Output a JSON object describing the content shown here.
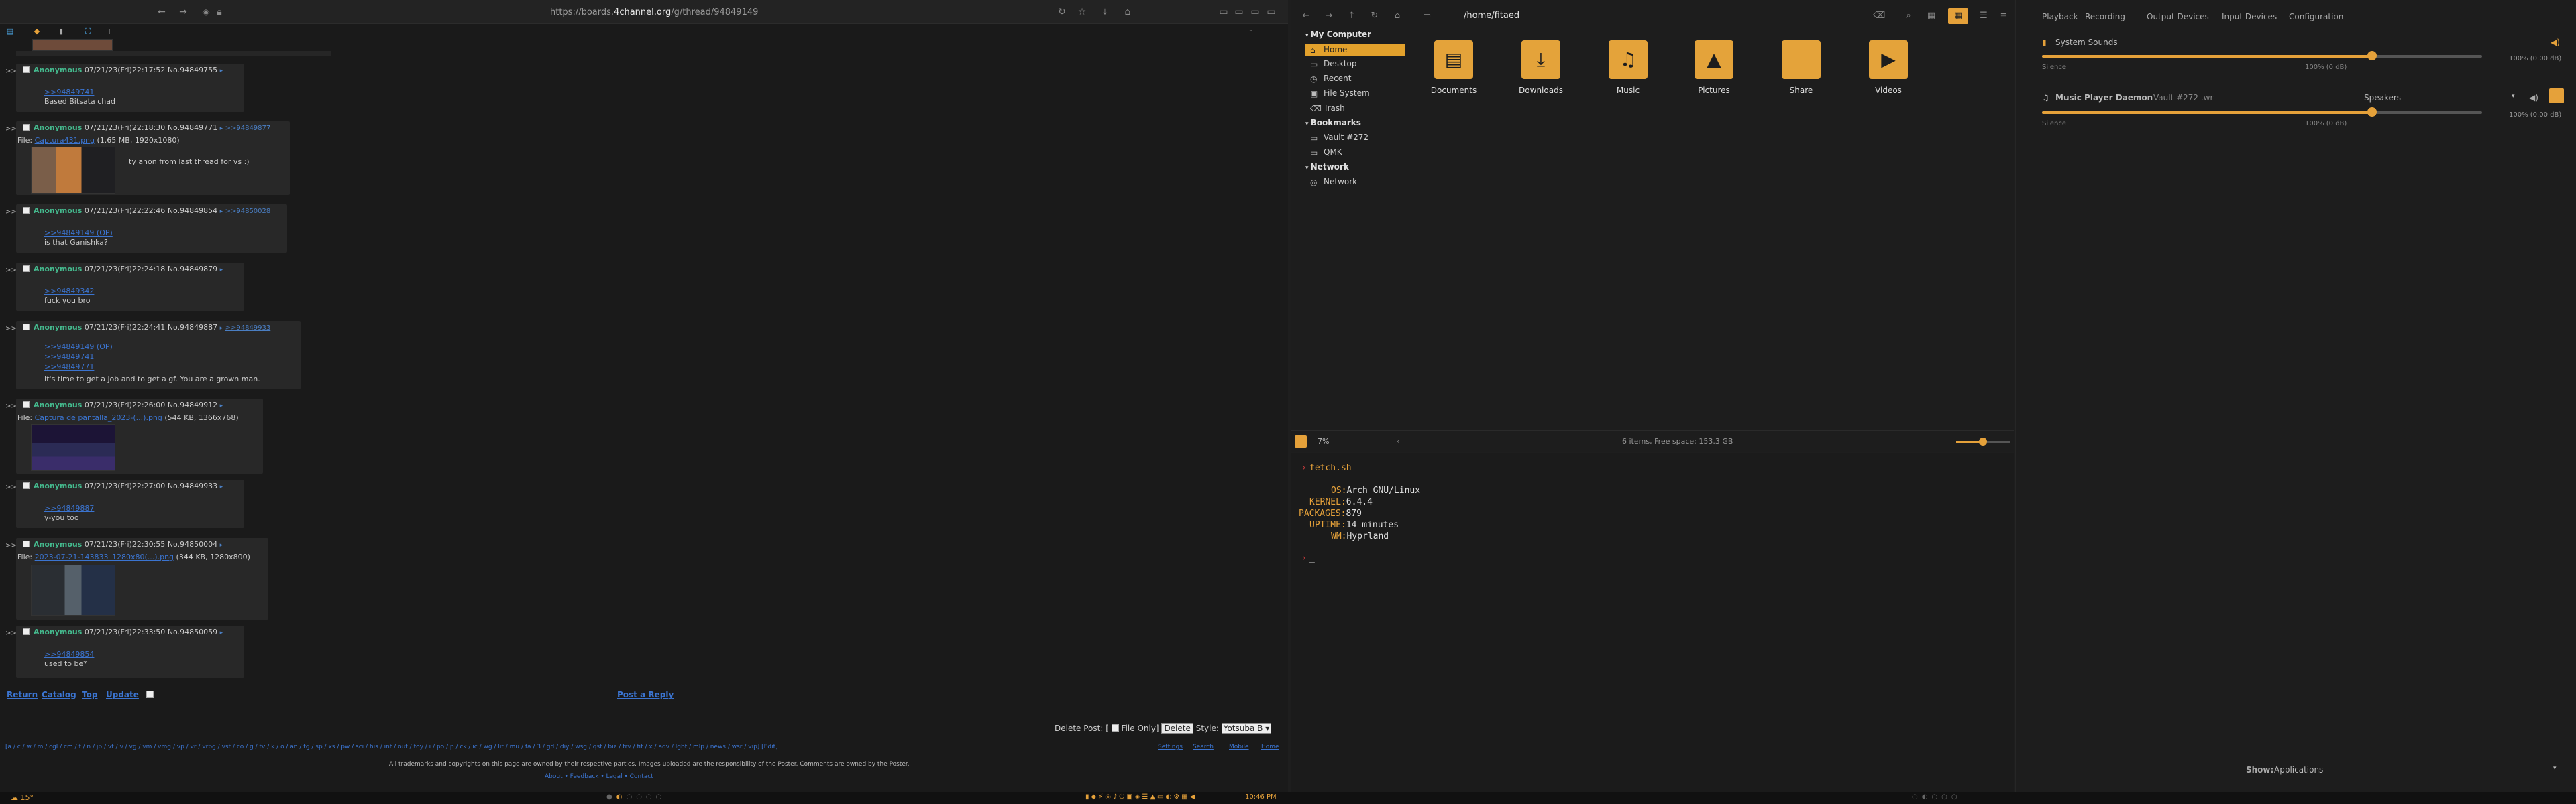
{
  "browser": {
    "url_prefix": "https://boards.",
    "url_domain": "4channel.org",
    "url_suffix": "/g/thread/94849149",
    "posts": [
      {
        "name": "Anonymous",
        "date": "07/21/23(Fri)22:17:52",
        "no": "No.94849755",
        "quotes": [
          ">>94849741"
        ],
        "text": "Based Bitsata chad"
      },
      {
        "name": "Anonymous",
        "date": "07/21/23(Fri)22:18:30",
        "no": "No.94849771",
        "reply": ">>94849877",
        "file_label": "File:",
        "file_link": "Captura431.png",
        "file_meta": "(1.65 MB, 1920x1080)",
        "text": "ty anon from last thread for vs :)"
      },
      {
        "name": "Anonymous",
        "date": "07/21/23(Fri)22:22:46",
        "no": "No.94849854",
        "reply": ">>94850028",
        "quotes": [
          ">>94849149 (OP)"
        ],
        "text": "is that Ganishka?"
      },
      {
        "name": "Anonymous",
        "date": "07/21/23(Fri)22:24:18",
        "no": "No.94849879",
        "quotes": [
          ">>94849342"
        ],
        "text": "fuck you bro"
      },
      {
        "name": "Anonymous",
        "date": "07/21/23(Fri)22:24:41",
        "no": "No.94849887",
        "reply": ">>94849933",
        "quotes": [
          ">>94849149 (OP)",
          ">>94849741",
          ">>94849771"
        ],
        "text": "It's time to get a job and to get a gf. You are a grown man."
      },
      {
        "name": "Anonymous",
        "date": "07/21/23(Fri)22:26:00",
        "no": "No.94849912",
        "file_label": "File:",
        "file_link": "Captura de pantalla_2023-(...).png",
        "file_meta": "(544 KB, 1366x768)"
      },
      {
        "name": "Anonymous",
        "date": "07/21/23(Fri)22:27:00",
        "no": "No.94849933",
        "quotes": [
          ">>94849887"
        ],
        "text": "y-you too"
      },
      {
        "name": "Anonymous",
        "date": "07/21/23(Fri)22:30:55",
        "no": "No.94850004",
        "file_label": "File:",
        "file_link": "2023-07-21-143833_1280x80(...).png",
        "file_meta": "(344 KB, 1280x800)"
      },
      {
        "name": "Anonymous",
        "date": "07/21/23(Fri)22:33:50",
        "no": "No.94850059",
        "quotes": [
          ">>94849854"
        ],
        "text": "used to be*"
      }
    ],
    "post_prefix": ">>",
    "nav": {
      "return": "Return",
      "catalog": "Catalog",
      "top": "Top",
      "update": "Update"
    },
    "post_reply": "Post a Reply",
    "delete_post": "Delete Post: [",
    "file_only": "File Only]",
    "delete": "Delete",
    "style_label": "Style:",
    "style_value": "Yotsuba B",
    "boards": "[a / c / w / m / cgl / cm / f / n / jp / vt / v / vg / vm / vmg / vp / vr / vrpg / vst / co / g / tv / k / o / an / tg / sp / xs / pw / sci / his / int / out / toy / i / po / p / ck / ic / wg / lit / mu / fa / 3 / gd / diy / wsg / qst / biz / trv / fit / x / adv / lgbt / mlp / news / wsr / vip] [Edit]",
    "settings": "Settings",
    "search": "Search",
    "mobile": "Mobile",
    "home": "Home",
    "disclaimer": "All trademarks and copyrights on this page are owned by their respective parties. Images uploaded are the responsibility of the Poster. Comments are owned by the Poster.",
    "footer_links": "About • Feedback • Legal • Contact"
  },
  "filemanager": {
    "path": "/home/fitaed",
    "my_computer": "My Computer",
    "places": [
      "Home",
      "Desktop",
      "Recent",
      "File System",
      "Trash"
    ],
    "bookmarks_hdr": "Bookmarks",
    "bookmarks": [
      "Vault #272",
      "QMK"
    ],
    "network_hdr": "Network",
    "network": [
      "Network"
    ],
    "folders": [
      "Documents",
      "Downloads",
      "Music",
      "Pictures",
      "Share",
      "Videos"
    ],
    "zoom": "7%",
    "status": "6 items, Free space: 153.3 GB"
  },
  "terminal": {
    "title": "fetch.sh",
    "lines": [
      {
        "k": "OS:",
        "v": "Arch GNU/Linux"
      },
      {
        "k": "KERNEL:",
        "v": "6.4.4"
      },
      {
        "k": "PACKAGES:",
        "v": "879"
      },
      {
        "k": "UPTIME:",
        "v": "14 minutes"
      },
      {
        "k": "WM:",
        "v": "Hyprland"
      }
    ],
    "prompt": "_"
  },
  "mixer": {
    "tabs": [
      "Playback",
      "Recording",
      "Output Devices",
      "Input Devices",
      "Configuration"
    ],
    "streams": [
      {
        "name": "System Sounds",
        "left": "Silence",
        "mid": "100% (0 dB)",
        "right": "100% (0.00 dB)",
        "level": 0.75
      },
      {
        "name": "Music Player Daemon",
        "sub": "Vault #272 .wr",
        "device": "Speakers",
        "left": "Silence",
        "mid": "100% (0 dB)",
        "right": "100% (0.00 dB)",
        "level": 0.75
      }
    ],
    "show_label": "Show:",
    "show_value": "Applications"
  },
  "bar": {
    "weather": "☁ 15°",
    "clock": "10:46 PM"
  },
  "colors": {
    "accent": "#e5a13a",
    "link": "#3b74d0",
    "name": "#44b98d"
  }
}
